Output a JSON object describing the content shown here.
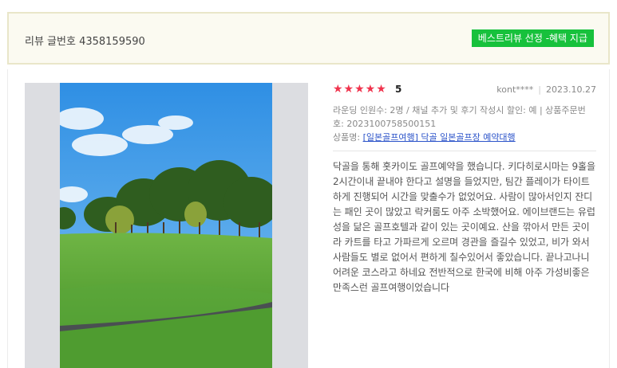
{
  "header": {
    "review_number": "리뷰 글번호 4358159590",
    "best_badge": "베스트리뷰 선정 -혜택 지급"
  },
  "review": {
    "stars": "★★★★★",
    "score": "5",
    "author": "kont****",
    "date": "2023.10.27",
    "info_text": "라운딩 인원수: 2명 / 채널 추가 및 후기 작성시 할인: 예 | 상품주문번호: 2023100758500151",
    "product_label": "상품명: ",
    "product_link": "[일본골프여행] 닥골 일본골프장 예약대행",
    "body": "닥골을 통해 홋카이도 골프예약을 했습니다. 키다히로시마는 9홀을 2시간이내 끝내야 한다고 설명을 들었지만, 팀간 플레이가 타이트하게 진행되어 시간을 맞출수가 없었어요. 사람이 많아서인지 잔디는 패인 곳이 많았고 락커룸도 아주 소박했어요. 에이브랜드는 유럽성을 닮은 골프호텔과 같이 있는 곳이예요. 산을 깎아서 만든 곳이라 카트를 타고 가파르게 오르며 경관을 즐길수 있었고, 비가 와서 사람들도 별로 없어서 편하게 칠수있어서 좋았습니다. 끝나고나니 어려운 코스라고 하네요 전반적으로 한국에 비해 아주 가성비좋은 만족스런 골프여행이었습니다"
  },
  "colors": {
    "badge": "#17c13c",
    "stars": "#f0334d",
    "link": "#2b53c9"
  }
}
